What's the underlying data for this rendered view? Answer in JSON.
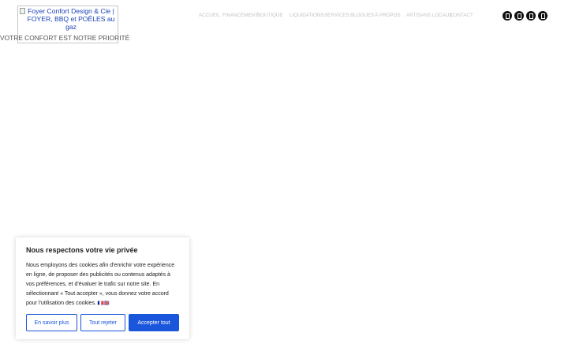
{
  "header": {
    "logo_alt": "Foyer Confort Design & Cie | FOYER, BBQ et POÊLES au gaz",
    "tagline": "VOTRE CONFORT EST NOTRE PRIORITÉ"
  },
  "nav": {
    "items": [
      {
        "label": "ACCUEIL"
      },
      {
        "label": "FINANCEMENT"
      },
      {
        "label": "BOUTIQUE"
      },
      {
        "label": "LIQUIDATIONS"
      },
      {
        "label": "SERVICES"
      },
      {
        "label": "BLOGUES"
      },
      {
        "label": "À PROPOS"
      },
      {
        "label": "ARTISANS LOCAUX"
      },
      {
        "label": "CONTACT"
      }
    ]
  },
  "social": {
    "icons": [
      "facebook-icon",
      "instagram-icon",
      "youtube-icon",
      "pinterest-icon"
    ]
  },
  "cookie": {
    "title": "Nous respectons votre vie privée",
    "body": "Nous employons des cookies afin d'enrichir votre expérience en ligne, de proposer des publicités ou contenus adaptés à vos préférences, et d'évaluer le trafic sur notre site. En sélectionnant « Tout accepter », vous donnez votre accord pour l'utilisation des cookies.",
    "flags": "🇫🇷🇬🇧",
    "learn_more": "En savoir plus",
    "reject_all": "Tout rejeter",
    "accept_all": "Accepter tout",
    "accent_color": "#1a56db"
  }
}
